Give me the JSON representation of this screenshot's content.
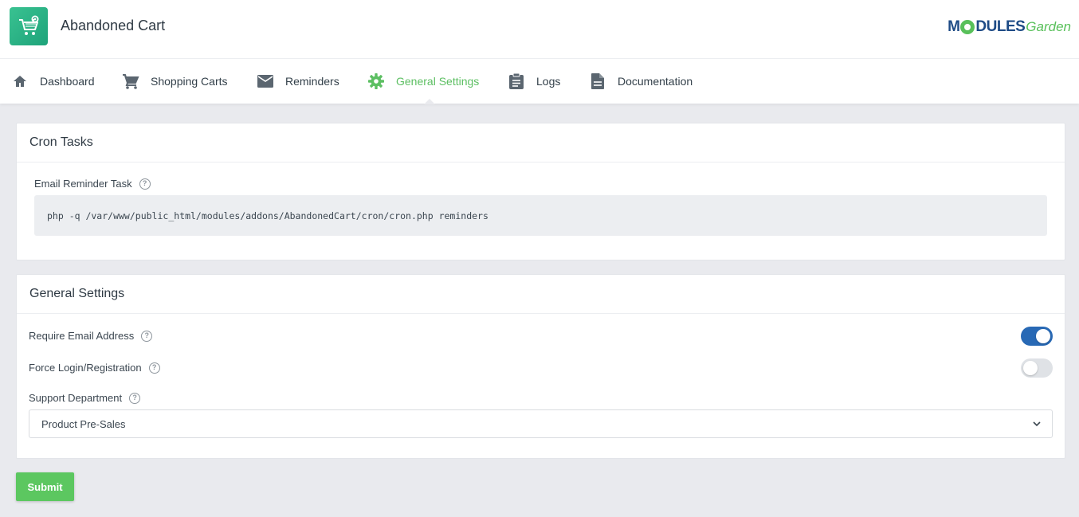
{
  "header": {
    "title": "Abandoned Cart",
    "brand_part1": "M",
    "brand_part2": "DULES",
    "brand_part3": "Garden"
  },
  "nav": {
    "items": [
      {
        "label": "Dashboard",
        "icon": "home-icon"
      },
      {
        "label": "Shopping Carts",
        "icon": "cart-icon"
      },
      {
        "label": "Reminders",
        "icon": "mail-icon"
      },
      {
        "label": "General Settings",
        "icon": "gear-icon",
        "active": true
      },
      {
        "label": "Logs",
        "icon": "clipboard-icon"
      },
      {
        "label": "Documentation",
        "icon": "document-icon"
      }
    ]
  },
  "cron": {
    "title": "Cron Tasks",
    "label": "Email Reminder Task",
    "command": "php -q /var/www/public_html/modules/addons/AbandonedCart/cron/cron.php reminders"
  },
  "settings": {
    "title": "General Settings",
    "require_email": {
      "label": "Require Email Address",
      "enabled": true
    },
    "force_login": {
      "label": "Force Login/Registration",
      "enabled": false
    },
    "support_department": {
      "label": "Support Department",
      "value": "Product Pre-Sales"
    }
  },
  "actions": {
    "submit_label": "Submit"
  },
  "colors": {
    "accent": "#5cbf62",
    "toggle_on": "#2869b5",
    "brand_blue": "#1e4b86"
  }
}
